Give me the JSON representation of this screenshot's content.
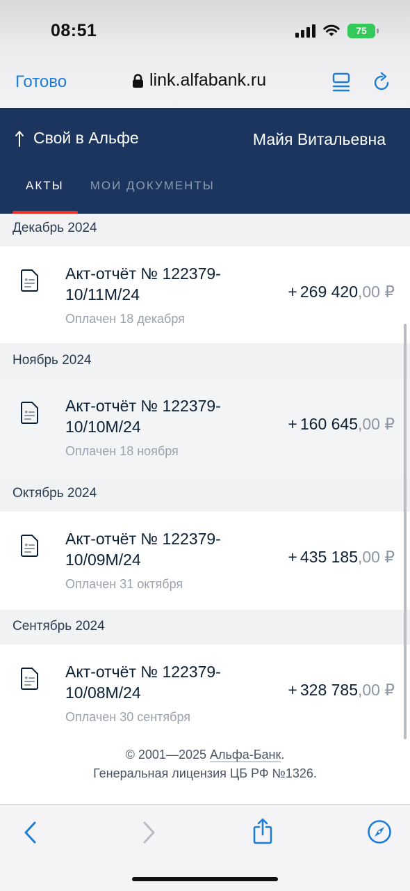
{
  "status_bar": {
    "time": "08:51",
    "battery": "75"
  },
  "browser": {
    "done_label": "Готово",
    "url": "link.alfabank.ru"
  },
  "header": {
    "brand": "Свой в Альфе",
    "user_name": "Майя Витальевна",
    "tabs": [
      {
        "label": "АКТЫ",
        "active": true
      },
      {
        "label": "МОИ ДОКУМЕНТЫ",
        "active": false
      }
    ]
  },
  "groups": [
    {
      "month": "Декабрь 2024",
      "title_line1": "Акт-отчёт № 122379-",
      "title_line2": "10/11М/24",
      "status": "Оплачен 18 декабря",
      "sign": "+",
      "amount_main": "269 420",
      "amount_cents": ",00 ₽"
    },
    {
      "month": "Ноябрь 2024",
      "title_line1": "Акт-отчёт № 122379-",
      "title_line2": "10/10М/24",
      "status": "Оплачен 18 ноября",
      "sign": "+",
      "amount_main": "160 645",
      "amount_cents": ",00 ₽"
    },
    {
      "month": "Октябрь 2024",
      "title_line1": "Акт-отчёт № 122379-",
      "title_line2": "10/09М/24",
      "status": "Оплачен 31 октября",
      "sign": "+",
      "amount_main": "435 185",
      "amount_cents": ",00 ₽"
    },
    {
      "month": "Сентябрь 2024",
      "title_line1": "Акт-отчёт № 122379-",
      "title_line2": "10/08М/24",
      "status": "Оплачен 30 сентября",
      "sign": "+",
      "amount_main": "328 785",
      "amount_cents": ",00 ₽"
    }
  ],
  "footer": {
    "copyright_prefix": "© 2001—2025 ",
    "bank_link": "Альфа-Банк",
    "copyright_suffix": ".",
    "license": "Генеральная лицензия ЦБ РФ №1326."
  },
  "colors": {
    "header_bg": "#1c355e",
    "tab_underline": "#ef3124",
    "link_blue": "#1c7cd6",
    "battery_green": "#34c759"
  },
  "icons": [
    "lock-icon",
    "reader-mode-icon",
    "reload-icon",
    "arrow-up-icon",
    "document-icon",
    "back-icon",
    "forward-icon",
    "share-icon",
    "compass-icon"
  ]
}
